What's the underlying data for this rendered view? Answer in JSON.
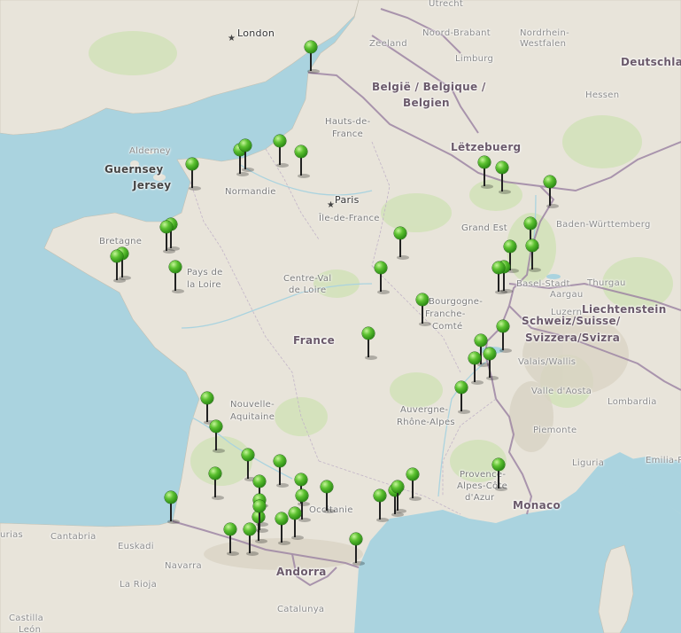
{
  "map": {
    "colors": {
      "sea": "#aad3df",
      "land": "#e8e4da",
      "marker": "#3aa51c",
      "border": "#9e86a4"
    },
    "labels": {
      "utrecht": "Utrecht",
      "london": "London",
      "zeeland": "Zeeland",
      "noord_brabant": "Noord-Brabant",
      "nordrhein": "Nordrhein-",
      "westfalen": "Westfalen",
      "limburg": "Limburg",
      "deutschland": "Deutschlan",
      "belgie1": "België / Belgique /",
      "belgie2": "Belgien",
      "hessen": "Hessen",
      "hauts1": "Hauts-de-",
      "hauts2": "France",
      "letzebuerg": "Lëtzebuerg",
      "alderney": "Alderney",
      "guernsey": "Guernsey",
      "jersey": "Jersey",
      "normandie": "Normandie",
      "paris": "Paris",
      "idf": "Île-de-France",
      "grand_est": "Grand Est",
      "baden": "Baden-Württemberg",
      "bretagne": "Bretagne",
      "pdl1": "Pays de",
      "pdl2": "la Loire",
      "cvl1": "Centre-Val",
      "cvl2": "de Loire",
      "bfc1": "Bourgogne-",
      "bfc2": "Franche-",
      "bfc3": "Comté",
      "basel": "Basel-Stadt",
      "thurgau": "Thurgau",
      "aargau": "Aargau",
      "liechtenstein": "Liechtenstein",
      "schweiz1": "Schweiz/Suisse/",
      "schweiz2": "Svizzera/Svizra",
      "luzern": "Luzern",
      "france": "France",
      "valais": "Valais/Wallis",
      "na1": "Nouvelle-",
      "na2": "Aquitaine",
      "aosta": "Valle d'Aosta",
      "lombardia": "Lombardia",
      "ara1": "Auvergne-",
      "ara2": "Rhône-Alpes",
      "piemonte": "Piemonte",
      "emilia": "Emilia-Ro",
      "liguria": "Liguria",
      "paca1": "Provence-",
      "paca2": "Alpes-Côte",
      "paca3": "d'Azur",
      "monaco": "Monaco",
      "occitanie": "Occitanie",
      "asturias": "urias",
      "cantabria": "Cantabria",
      "euskadi": "Euskadi",
      "andorra": "Andorra",
      "navarra": "Navarra",
      "larioja": "La Rioja",
      "catalunya": "Catalunya",
      "castilla": "Castilla",
      "leon": "León"
    },
    "markers": [
      {
        "name": "Calais"
      },
      {
        "name": "Le Havre"
      },
      {
        "name": "Étretat"
      },
      {
        "name": "Honfleur"
      },
      {
        "name": "Rouen"
      },
      {
        "name": "Lyons-la-Forêt"
      },
      {
        "name": "Mont-Saint-Michel"
      },
      {
        "name": "Metz"
      },
      {
        "name": "Château de Malbrouck"
      },
      {
        "name": "Strasbourg"
      },
      {
        "name": "Saint-Malo"
      },
      {
        "name": "Dinan"
      },
      {
        "name": "Quimper"
      },
      {
        "name": "Locronan"
      },
      {
        "name": "Rennes"
      },
      {
        "name": "Troyes"
      },
      {
        "name": "Colmar"
      },
      {
        "name": "Riquewihr"
      },
      {
        "name": "Mulhouse"
      },
      {
        "name": "Bourges"
      },
      {
        "name": "Belfort"
      },
      {
        "name": "Basel border"
      },
      {
        "name": "Dijon"
      },
      {
        "name": "Nevers"
      },
      {
        "name": "Geneva"
      },
      {
        "name": "Annecy"
      },
      {
        "name": "Chambéry"
      },
      {
        "name": "Aix-les-Bains"
      },
      {
        "name": "Grenoble"
      },
      {
        "name": "La Rochelle"
      },
      {
        "name": "Saintes"
      },
      {
        "name": "Bordeaux"
      },
      {
        "name": "Périgueux"
      },
      {
        "name": "Sarlat"
      },
      {
        "name": "Biarritz"
      },
      {
        "name": "Cahors"
      },
      {
        "name": "Albi"
      },
      {
        "name": "Montauban"
      },
      {
        "name": "Toulouse"
      },
      {
        "name": "Carcassonne"
      },
      {
        "name": "Pau"
      },
      {
        "name": "Lourdes"
      },
      {
        "name": "Foix"
      },
      {
        "name": "Montpellier"
      },
      {
        "name": "Nîmes"
      },
      {
        "name": "Arles"
      },
      {
        "name": "Avignon"
      },
      {
        "name": "Gordes"
      },
      {
        "name": "Collioure"
      },
      {
        "name": "Moissac"
      },
      {
        "name": "Auch"
      }
    ]
  }
}
